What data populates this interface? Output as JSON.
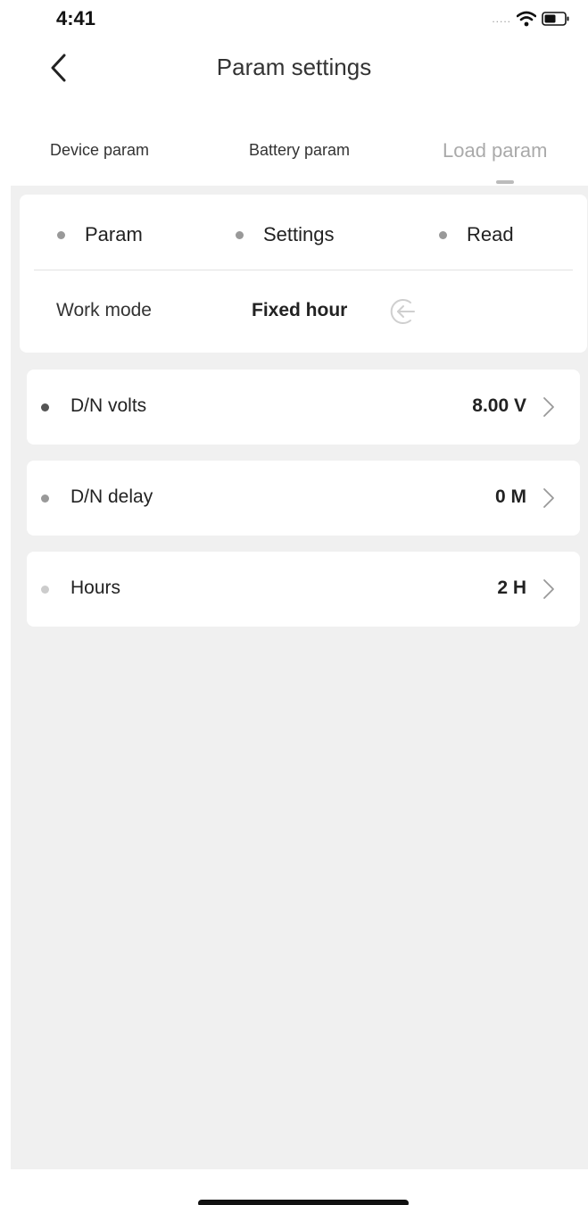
{
  "status_bar": {
    "time": "4:41",
    "signal": "....."
  },
  "nav": {
    "title": "Param settings"
  },
  "tabs": [
    {
      "label": "Device param",
      "active": false
    },
    {
      "label": "Battery param",
      "active": false
    },
    {
      "label": "Load param",
      "active": true
    }
  ],
  "header": {
    "items": [
      {
        "label": "Param"
      },
      {
        "label": "Settings"
      },
      {
        "label": "Read"
      }
    ],
    "work_mode_label": "Work mode",
    "work_mode_value": "Fixed hour"
  },
  "rows": [
    {
      "label": "D/N volts",
      "value": "8.00 V",
      "dot_color": "#555555"
    },
    {
      "label": "D/N delay",
      "value": "0 M",
      "dot_color": "#999999"
    },
    {
      "label": "Hours",
      "value": "2 H",
      "dot_color": "#cccccc"
    }
  ],
  "colors": {
    "background": "#f0f0f0",
    "card": "#ffffff",
    "active_tab": "#aaaaaa"
  }
}
